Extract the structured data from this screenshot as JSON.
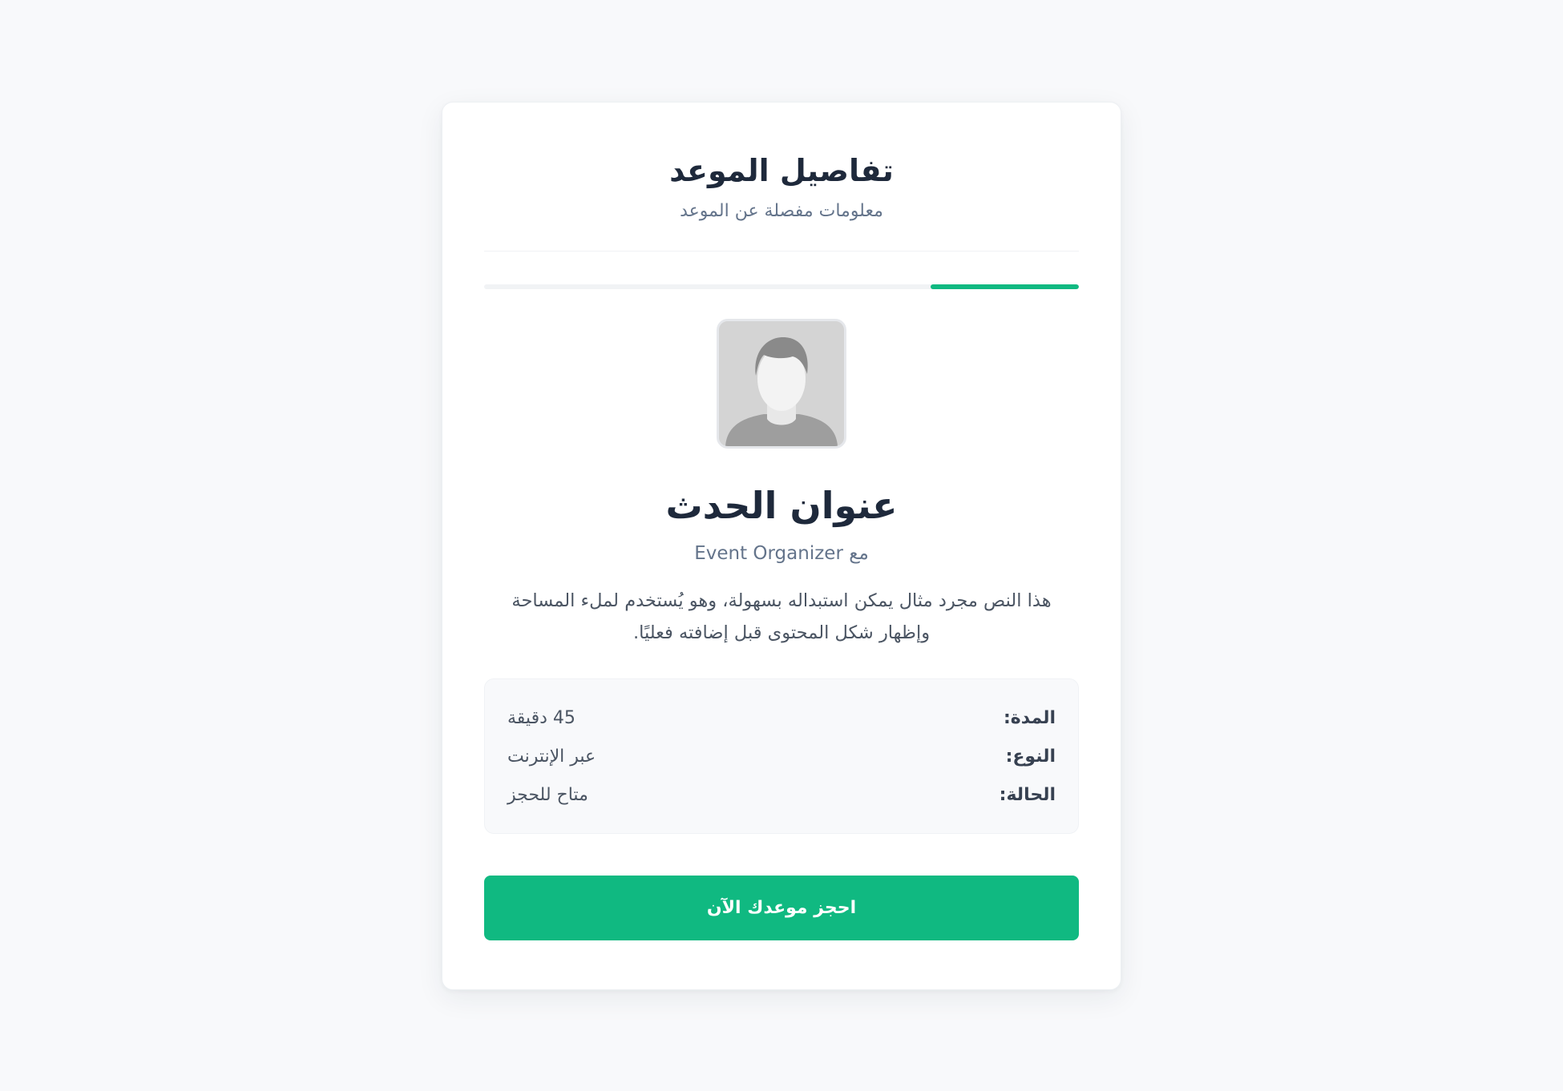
{
  "header": {
    "title": "تفاصيل الموعد",
    "subtitle": "معلومات مفصلة عن الموعد"
  },
  "progress": {
    "percent": 25,
    "color": "#10b981"
  },
  "avatar": {
    "icon": "user-avatar-placeholder-icon"
  },
  "event": {
    "title": "عنوان الحدث",
    "organizer": "مع Event Organizer",
    "description": "هذا النص مجرد مثال يمكن استبداله بسهولة، وهو يُستخدم لملء المساحة وإظهار شكل المحتوى قبل إضافته فعليًا."
  },
  "details": [
    {
      "label": "المدة:",
      "value": "45 دقيقة"
    },
    {
      "label": "النوع:",
      "value": "عبر الإنترنت"
    },
    {
      "label": "الحالة:",
      "value": "متاح للحجز"
    }
  ],
  "actions": {
    "book_label": "احجز موعدك الآن",
    "accent_color": "#10b981"
  }
}
